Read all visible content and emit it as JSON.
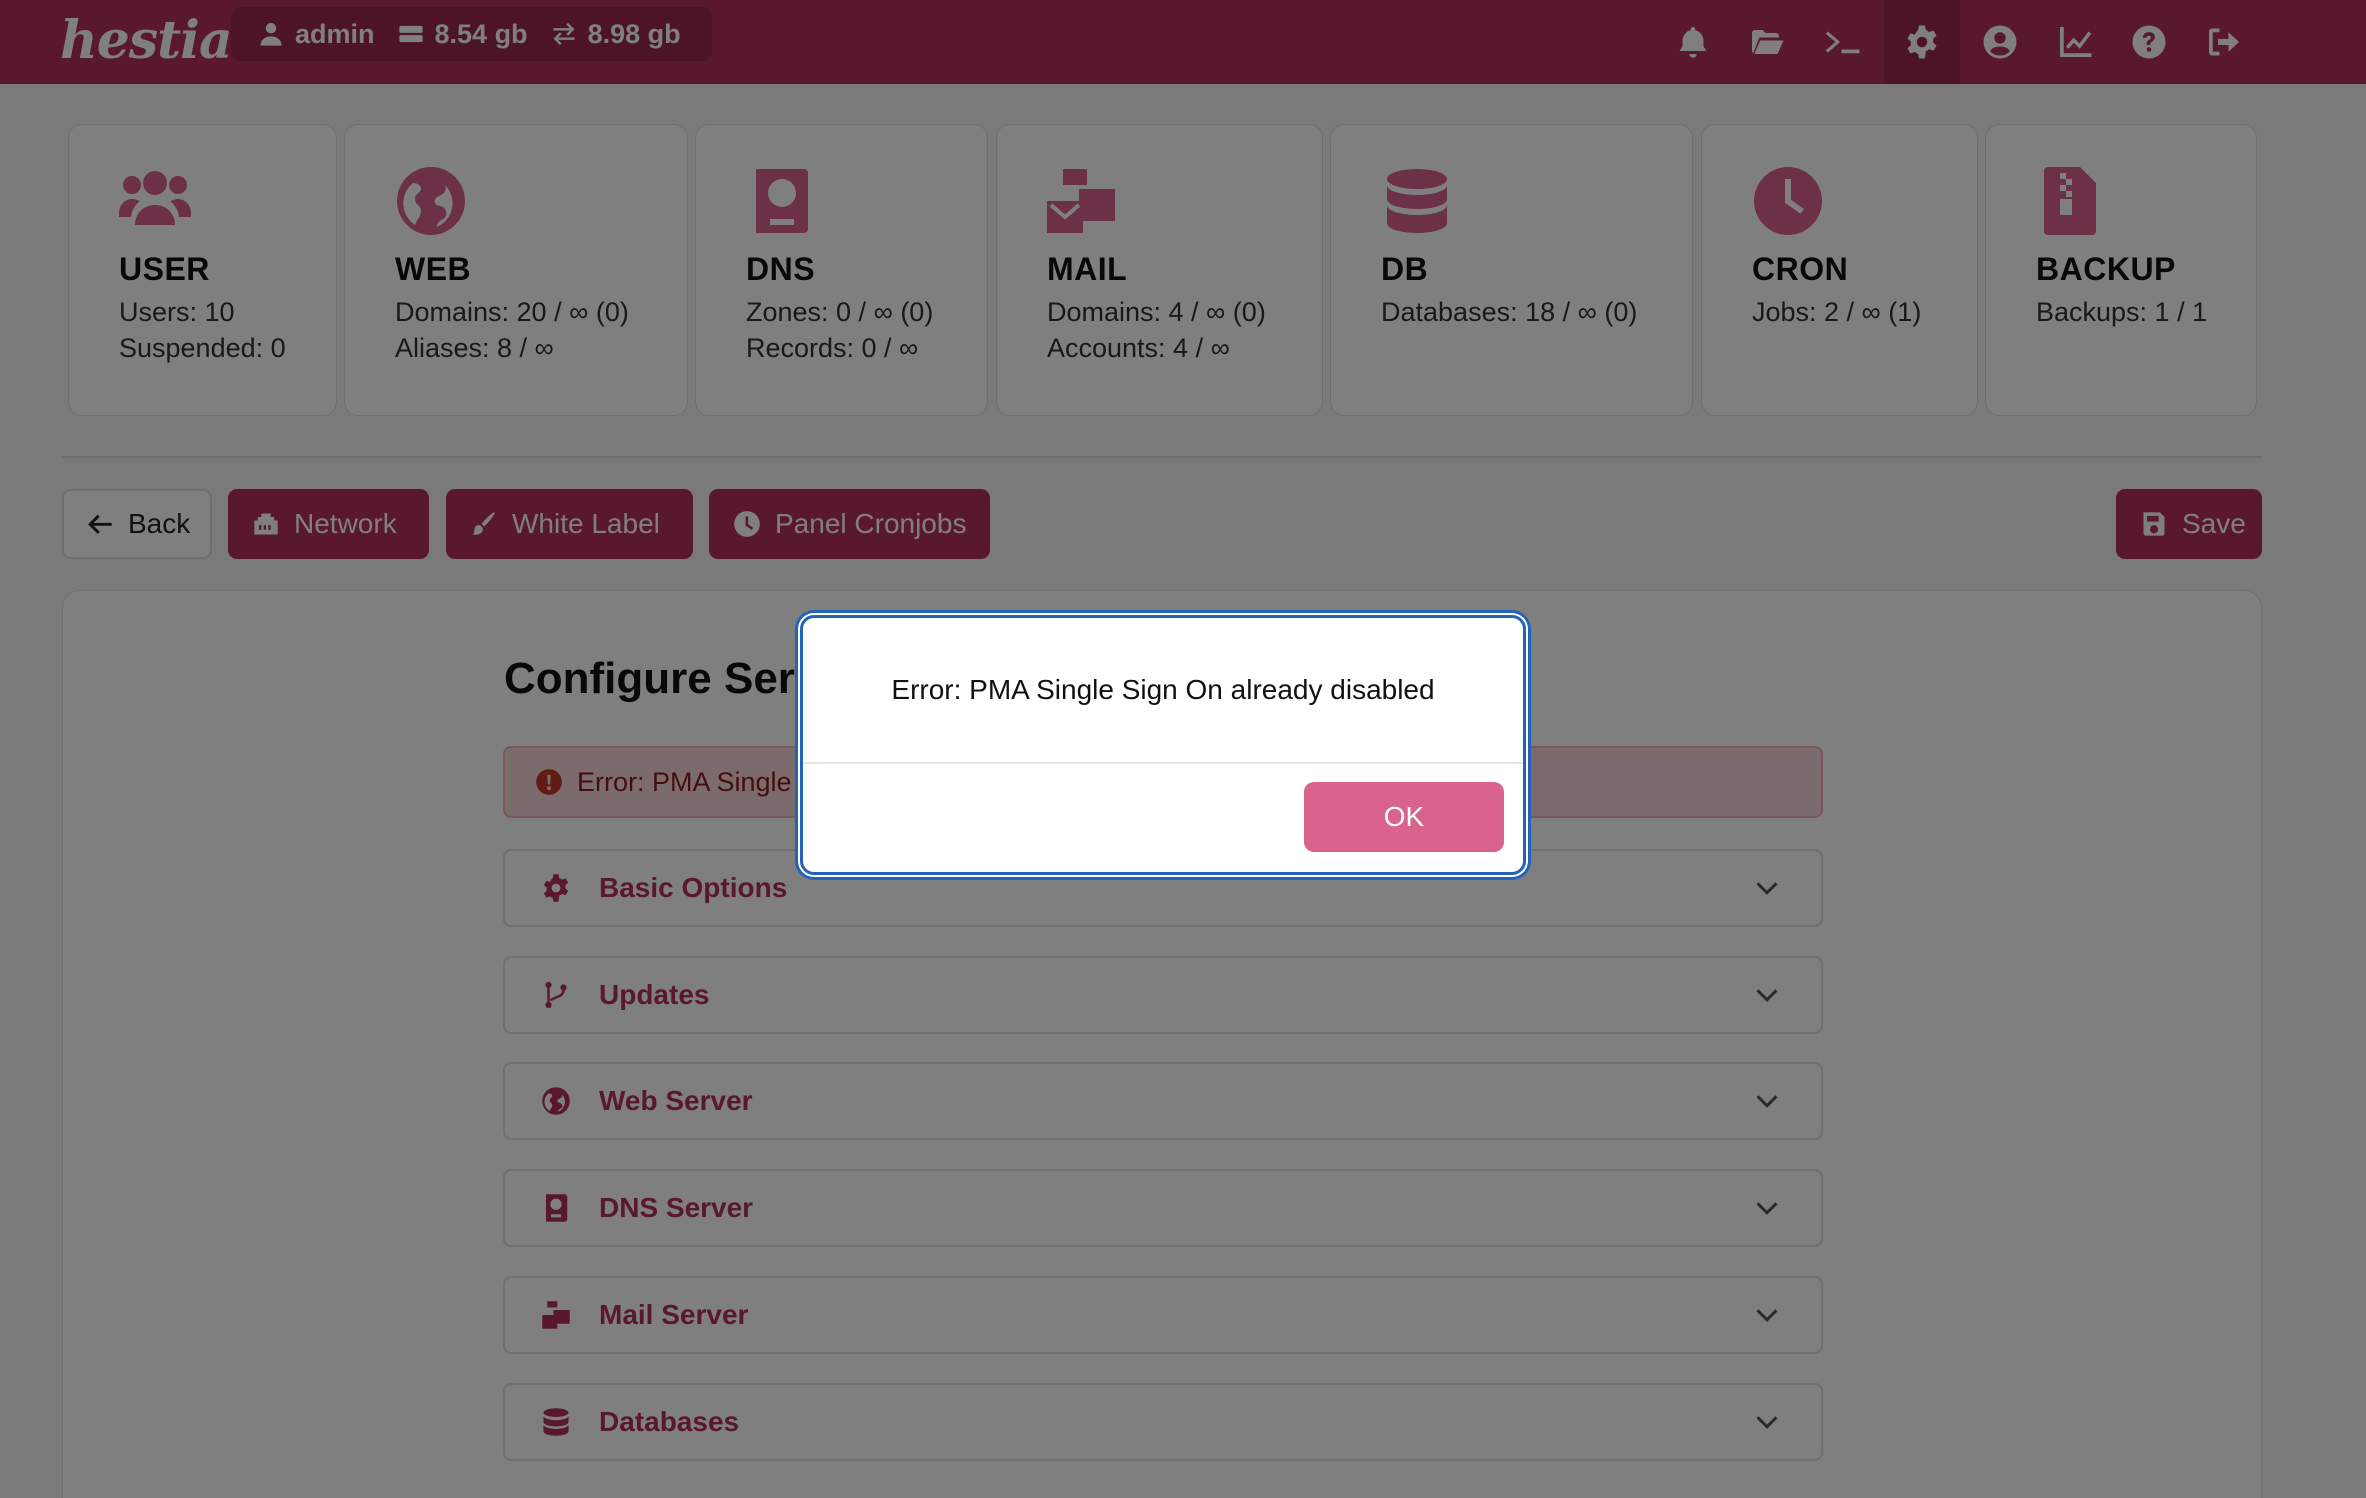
{
  "app": {
    "logo": "hestia"
  },
  "topbar": {
    "user": "admin",
    "disk": "8.54 gb",
    "bandwidth": "8.98 gb",
    "icons": [
      "bell-icon",
      "folder-icon",
      "terminal-icon",
      "gear-icon",
      "user-circle-icon",
      "chart-line-icon",
      "question-icon",
      "logout-icon"
    ]
  },
  "cards": [
    {
      "title": "USER",
      "line1": "Users: 10",
      "line2": "Suspended: 0",
      "icon": "users-icon"
    },
    {
      "title": "WEB",
      "line1": "Domains: 20 / ∞ (0)",
      "line2": "Aliases: 8 / ∞",
      "icon": "globe-icon"
    },
    {
      "title": "DNS",
      "line1": "Zones: 0 / ∞ (0)",
      "line2": "Records: 0 / ∞",
      "icon": "address-book-icon"
    },
    {
      "title": "MAIL",
      "line1": "Domains: 4 / ∞ (0)",
      "line2": "Accounts: 4 / ∞",
      "icon": "mail-bulk-icon"
    },
    {
      "title": "DB",
      "line1": "Databases: 18 / ∞ (0)",
      "line2": "",
      "icon": "database-icon"
    },
    {
      "title": "CRON",
      "line1": "Jobs: 2 / ∞ (1)",
      "line2": "",
      "icon": "clock-icon"
    },
    {
      "title": "BACKUP",
      "line1": "Backups: 1 / 1",
      "line2": "",
      "icon": "file-zipper-icon"
    }
  ],
  "toolbar": {
    "back": "Back",
    "network": "Network",
    "white_label": "White Label",
    "panel_cronjobs": "Panel Cronjobs",
    "save": "Save"
  },
  "main": {
    "title": "Configure Serv",
    "alert": "Error: PMA Single S",
    "sections": [
      "Basic Options",
      "Updates",
      "Web Server",
      "DNS Server",
      "Mail Server",
      "Databases"
    ]
  },
  "dialog": {
    "message": "Error: PMA Single Sign On already disabled",
    "ok": "OK"
  },
  "colors": {
    "brand": "#b5305f",
    "accent": "#d9638c",
    "dialog_border": "#2563b8"
  }
}
